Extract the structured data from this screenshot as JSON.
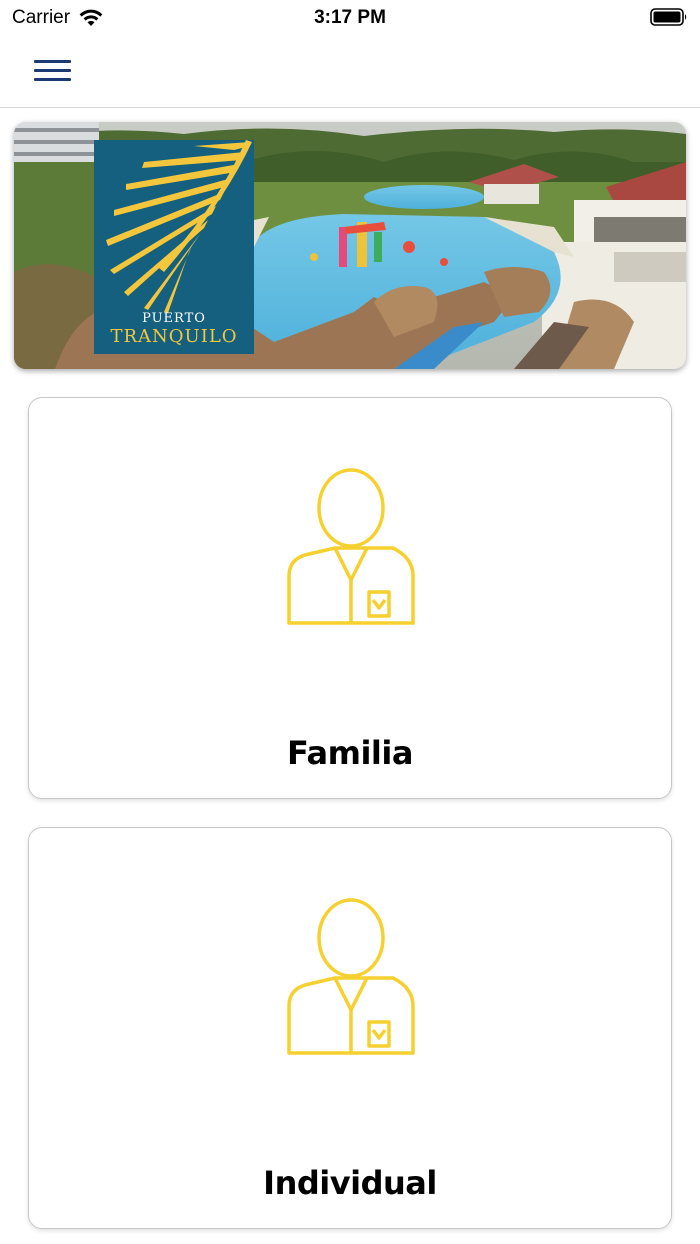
{
  "status_bar": {
    "carrier": "Carrier",
    "time": "3:17 PM",
    "icons": [
      "wifi-icon",
      "battery-icon"
    ]
  },
  "nav_bar": {
    "menu_icon": "hamburger-menu-icon"
  },
  "banner": {
    "logo_line1": "PUERTO",
    "logo_line2": "TRANQUILO",
    "logo_bg_color": "#16607f",
    "logo_accent_color": "#f3c63c"
  },
  "options": [
    {
      "label": "Familia",
      "icon": "person-badge-icon"
    },
    {
      "label": "Individual",
      "icon": "person-badge-icon"
    }
  ],
  "colors": {
    "accent": "#f5d02e",
    "menu": "#1b3a73"
  }
}
